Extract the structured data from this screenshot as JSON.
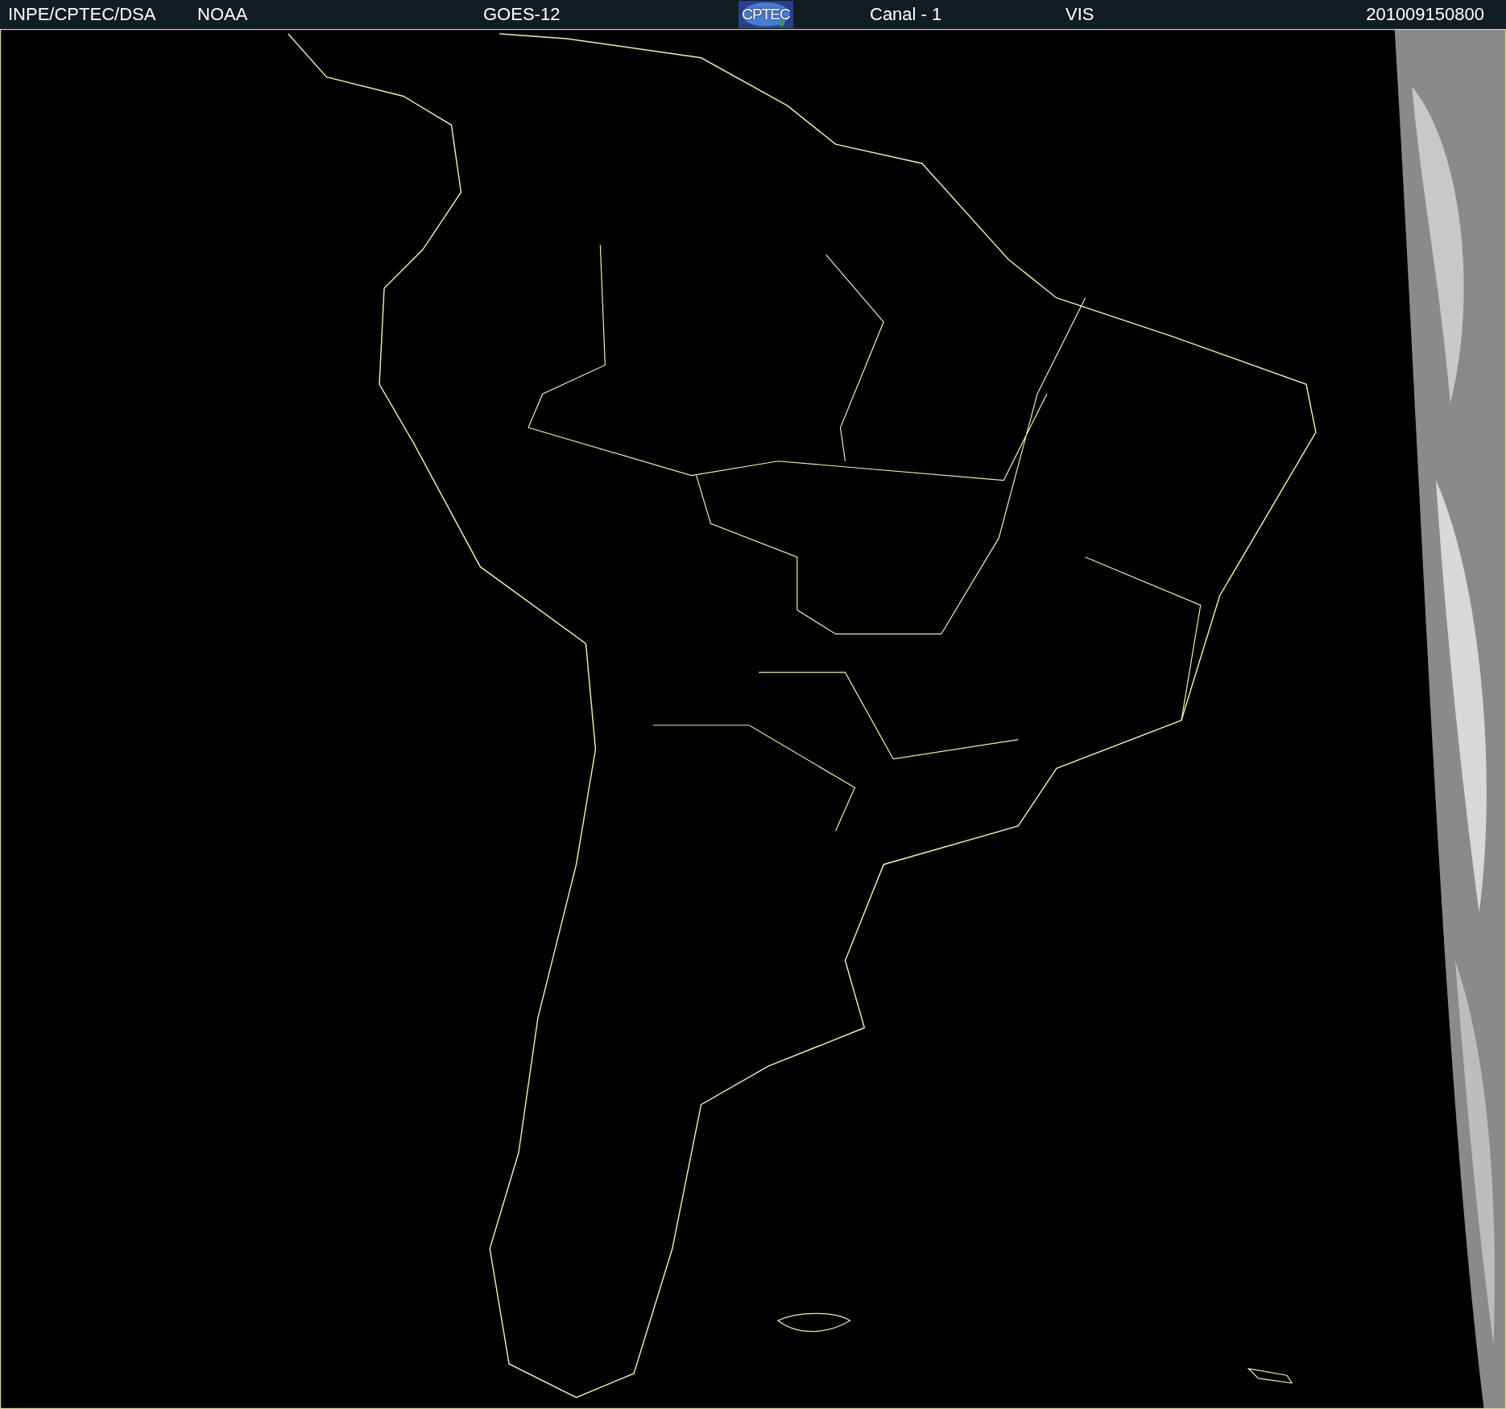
{
  "header": {
    "items": [
      {
        "kind": "text",
        "text": "INPE/CPTEC/DSA"
      },
      {
        "kind": "text",
        "text": "NOAA"
      },
      {
        "kind": "text",
        "text": "GOES-12"
      },
      {
        "kind": "logo",
        "text": "CPTEC"
      },
      {
        "kind": "text",
        "text": "Canal - 1"
      },
      {
        "kind": "text",
        "text": "VIS"
      },
      {
        "kind": "text",
        "text": "201009150800"
      }
    ]
  }
}
